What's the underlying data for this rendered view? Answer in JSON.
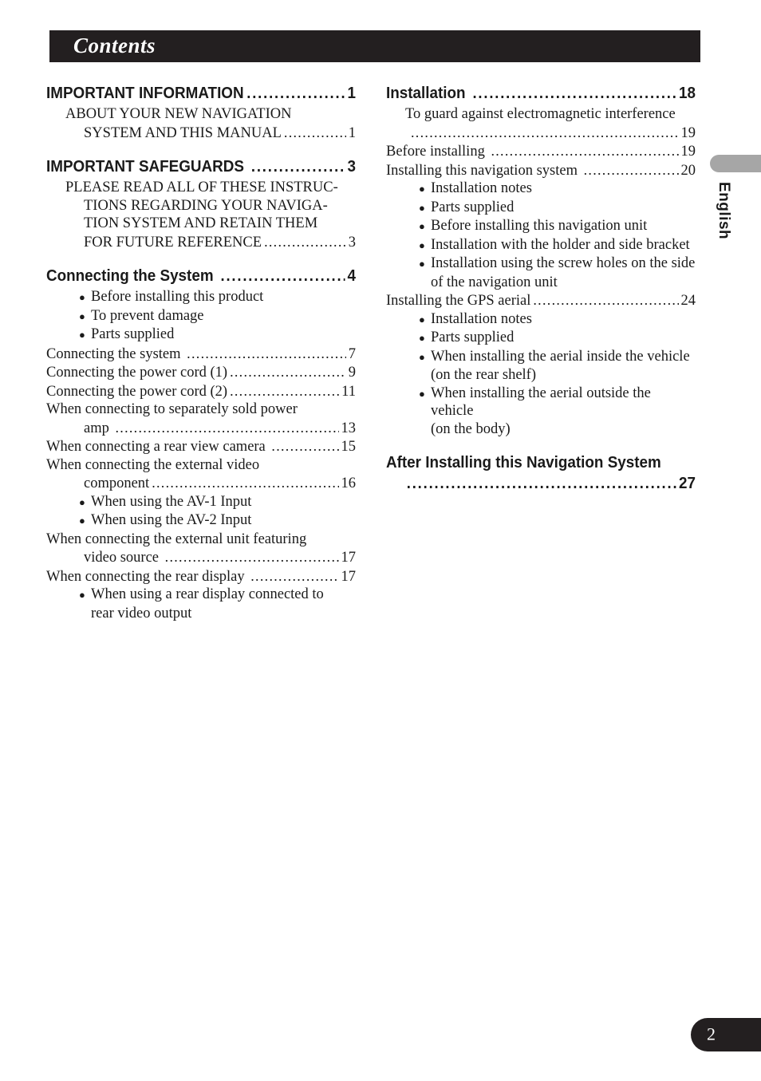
{
  "header": {
    "title": "Contents"
  },
  "side_tab": {
    "language_label": "English"
  },
  "footer": {
    "page_number": "2"
  },
  "leaders": {
    "dots_long": "................................................................................................................",
    "dots_heading": "................................................................................................................"
  },
  "bullet_glyph": "●",
  "toc": {
    "left_column": [
      {
        "kind": "heading",
        "label": "IMPORTANT INFORMATION",
        "page": "1"
      },
      {
        "kind": "sub",
        "label": "ABOUT YOUR NEW NAVIGATION",
        "page": ""
      },
      {
        "kind": "sub-cont",
        "label": "SYSTEM AND THIS MANUAL",
        "page": "1"
      },
      {
        "kind": "heading",
        "label": "IMPORTANT SAFEGUARDS ",
        "page": "3"
      },
      {
        "kind": "sub",
        "label": "PLEASE READ ALL OF THESE INSTRUC-",
        "page": ""
      },
      {
        "kind": "sub-cont-plain",
        "label": "TIONS REGARDING YOUR NAVIGA-",
        "page": ""
      },
      {
        "kind": "sub-cont-plain",
        "label": "TION SYSTEM AND RETAIN THEM",
        "page": ""
      },
      {
        "kind": "sub-cont",
        "label": "FOR FUTURE REFERENCE",
        "page": "3"
      },
      {
        "kind": "heading",
        "label": "Connecting the System ",
        "page": "4"
      },
      {
        "kind": "bullet",
        "label": "Before installing this product"
      },
      {
        "kind": "bullet",
        "label": "To prevent damage"
      },
      {
        "kind": "bullet",
        "label": "Parts supplied"
      },
      {
        "kind": "sub0",
        "label": "Connecting the system ",
        "page": "7"
      },
      {
        "kind": "sub0",
        "label": "Connecting the power cord (1)",
        "page": "9"
      },
      {
        "kind": "sub0",
        "label": "Connecting the power cord (2)",
        "page": "11"
      },
      {
        "kind": "sub0-nodots",
        "label": "When connecting to separately sold power",
        "page": ""
      },
      {
        "kind": "sub-cont",
        "label": "amp ",
        "page": "13"
      },
      {
        "kind": "sub0",
        "label": "When connecting a rear view camera ",
        "page": "15"
      },
      {
        "kind": "sub0-nodots",
        "label": "When connecting the external video",
        "page": ""
      },
      {
        "kind": "sub-cont",
        "label": "component",
        "page": "16"
      },
      {
        "kind": "bullet",
        "label": "When using the AV-1 Input"
      },
      {
        "kind": "bullet",
        "label": "When using the AV-2 Input"
      },
      {
        "kind": "sub0-nodots",
        "label": "When connecting the external unit featuring",
        "page": ""
      },
      {
        "kind": "sub-cont",
        "label": "video source ",
        "page": "17"
      },
      {
        "kind": "sub0",
        "label": "When connecting the rear display ",
        "page": "17"
      },
      {
        "kind": "bullet",
        "label": "When using a rear display connected to"
      },
      {
        "kind": "bullet-cont",
        "label": "rear video output"
      }
    ],
    "right_column": [
      {
        "kind": "heading",
        "label": "Installation ",
        "page": "18"
      },
      {
        "kind": "sub-nodots",
        "label": "To guard against electromagnetic interference",
        "page": ""
      },
      {
        "kind": "sub-cont-leaderonly",
        "label": "",
        "page": "19"
      },
      {
        "kind": "sub0",
        "label": "Before installing ",
        "page": "19"
      },
      {
        "kind": "sub0",
        "label": "Installing this navigation system ",
        "page": "20"
      },
      {
        "kind": "bullet",
        "label": "Installation notes"
      },
      {
        "kind": "bullet",
        "label": "Parts supplied"
      },
      {
        "kind": "bullet",
        "label": "Before installing this navigation unit"
      },
      {
        "kind": "bullet",
        "label": "Installation with the holder and side bracket"
      },
      {
        "kind": "bullet",
        "label": "Installation using the screw holes on the side"
      },
      {
        "kind": "bullet-cont",
        "label": "of the navigation unit"
      },
      {
        "kind": "sub0",
        "label": "Installing the GPS aerial",
        "page": "24"
      },
      {
        "kind": "bullet",
        "label": "Installation notes"
      },
      {
        "kind": "bullet",
        "label": "Parts supplied"
      },
      {
        "kind": "bullet",
        "label": "When installing the aerial inside the vehicle"
      },
      {
        "kind": "bullet-cont",
        "label": "(on the rear shelf)"
      },
      {
        "kind": "bullet",
        "label": "When installing the aerial outside the vehicle"
      },
      {
        "kind": "bullet-cont",
        "label": "(on the body)"
      },
      {
        "kind": "heading-wrap",
        "label": "After Installing this Navigation System",
        "page": "27"
      }
    ]
  }
}
